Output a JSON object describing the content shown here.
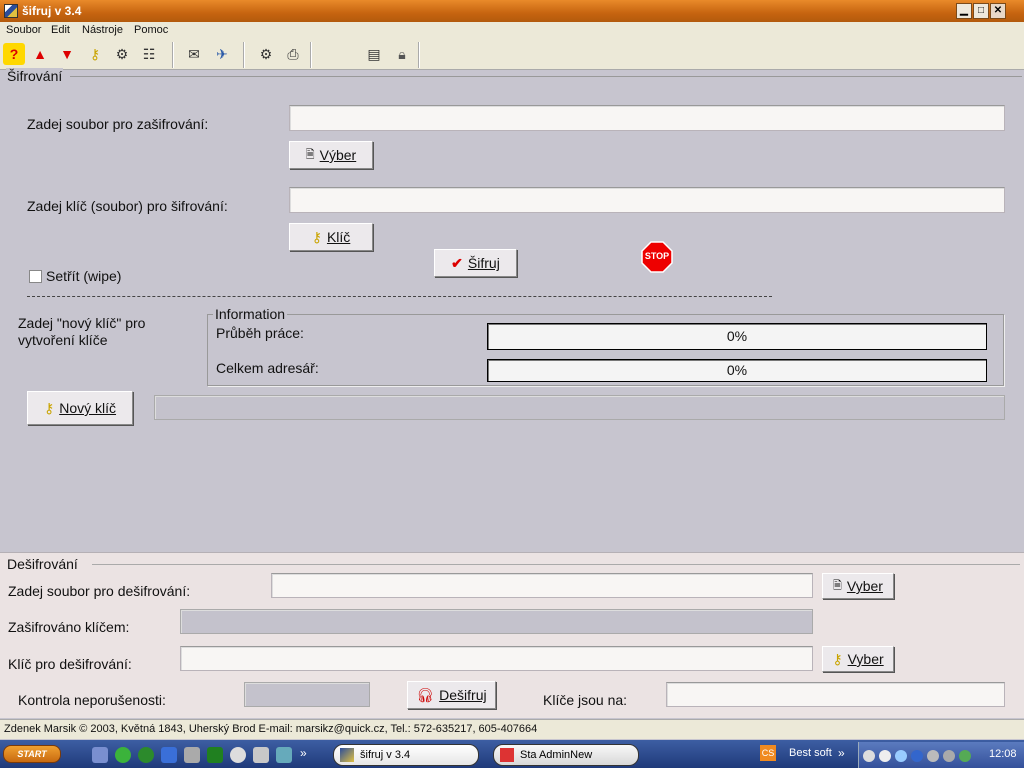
{
  "window": {
    "title": "šifruj v 3.4",
    "min": "▁",
    "max": "□",
    "close": "✕"
  },
  "menu": [
    "Soubor",
    "Edit",
    "Nástroje",
    "Pomoc"
  ],
  "toolbar_icons": [
    "help-icon",
    "arrow-up-icon",
    "arrow-down-icon",
    "key-icon",
    "gears-icon",
    "tree-icon",
    "mail-icon",
    "mail-send-icon",
    "network-icon",
    "printer-icon",
    "notes-icon",
    "lock-icon"
  ],
  "encrypt": {
    "section": "Šifrování",
    "file_label": "Zadej soubor pro zašifrování:",
    "file_value": "",
    "select_button": "Výber",
    "key_label": "Zadej klíč (soubor) pro šifrování:",
    "key_value": "",
    "key_button": "Klíč",
    "wipe_label": "Setřít (wipe)",
    "encrypt_button": "Šifruj",
    "stop_label": "STOP",
    "newkey_label": "Zadej  \"nový klíč\" pro vytvoření klíče",
    "newkey_button": "Nový klíč",
    "newkey_value": ""
  },
  "info": {
    "title": "Information",
    "progress_label": "Průběh práce:",
    "progress_value": "0%",
    "total_label": "Celkem adresář:",
    "total_value": "0%"
  },
  "decrypt": {
    "section": "Dešifrování",
    "file_label": "Zadej soubor pro dešifrování:",
    "file_value": "",
    "select_button": "Vyber",
    "encrypted_with_label": "Zašifrováno klíčem:",
    "key_label": "Klíč pro dešifrování:",
    "key_value": "",
    "key_button": "Vyber",
    "integrity_label": "Kontrola neporušenosti:",
    "decrypt_button": "Dešifruj",
    "keys_on_label": "Klíče jsou na:",
    "keys_on_value": ""
  },
  "footer": "Zdenek Marsik © 2003, Květná 1843, Uherský Brod   E-mail: marsikz@quick.cz, Tel.: 572-635217, 605-407664",
  "taskbar": {
    "start": "START",
    "tasks": [
      {
        "label": "šifruj v 3.4"
      },
      {
        "label": "Sta AdminNew"
      }
    ],
    "lang": "CS",
    "bestsoft": "Best soft",
    "more": "»",
    "clock": "12:08"
  }
}
